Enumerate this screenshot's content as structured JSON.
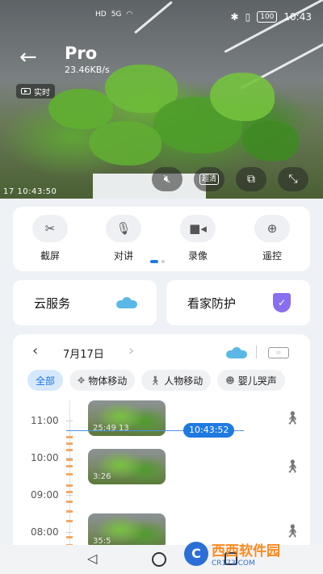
{
  "status_bar": {
    "left_icons": [
      "HD",
      "5G",
      "wifi"
    ],
    "battery": "100",
    "time": "10:43"
  },
  "device": {
    "title": "Pro",
    "speed": "23.46KB/s",
    "live_label": "实时",
    "timestamp": "17 10:43:50"
  },
  "video_controls": {
    "mute_icon": "speaker-mute-icon",
    "quality_label": "超清",
    "pip_icon": "picture-in-picture-icon",
    "fullscreen_icon": "fullscreen-icon"
  },
  "functions": [
    {
      "label": "截屏",
      "icon": "screenshot-icon"
    },
    {
      "label": "对讲",
      "icon": "microphone-icon"
    },
    {
      "label": "录像",
      "icon": "video-record-icon"
    },
    {
      "label": "遥控",
      "icon": "remote-control-icon"
    }
  ],
  "services": {
    "cloud_label": "云服务",
    "security_label": "看家防护"
  },
  "playback": {
    "date": "7月17日",
    "filters": [
      {
        "label": "全部",
        "active": true
      },
      {
        "label": "物体移动",
        "icon": "move-icon"
      },
      {
        "label": "人物移动",
        "icon": "person-walk-icon"
      },
      {
        "label": "婴儿哭声",
        "icon": "baby-icon"
      }
    ],
    "time_labels": [
      "11:00",
      "10:00",
      "09:00",
      "08:00"
    ],
    "current_time": "10:43:52",
    "clips": [
      {
        "caption": "25:49   13"
      },
      {
        "caption": "3:26"
      },
      {
        "caption": "35:5"
      }
    ]
  },
  "watermark": {
    "text": "西西软件园",
    "sub": "CR173.COM"
  },
  "colors": {
    "accent": "#1f7ae0",
    "cloud": "#5bb8e6",
    "shield": "#8a6ef0",
    "record_bar": "#f0a96b"
  }
}
